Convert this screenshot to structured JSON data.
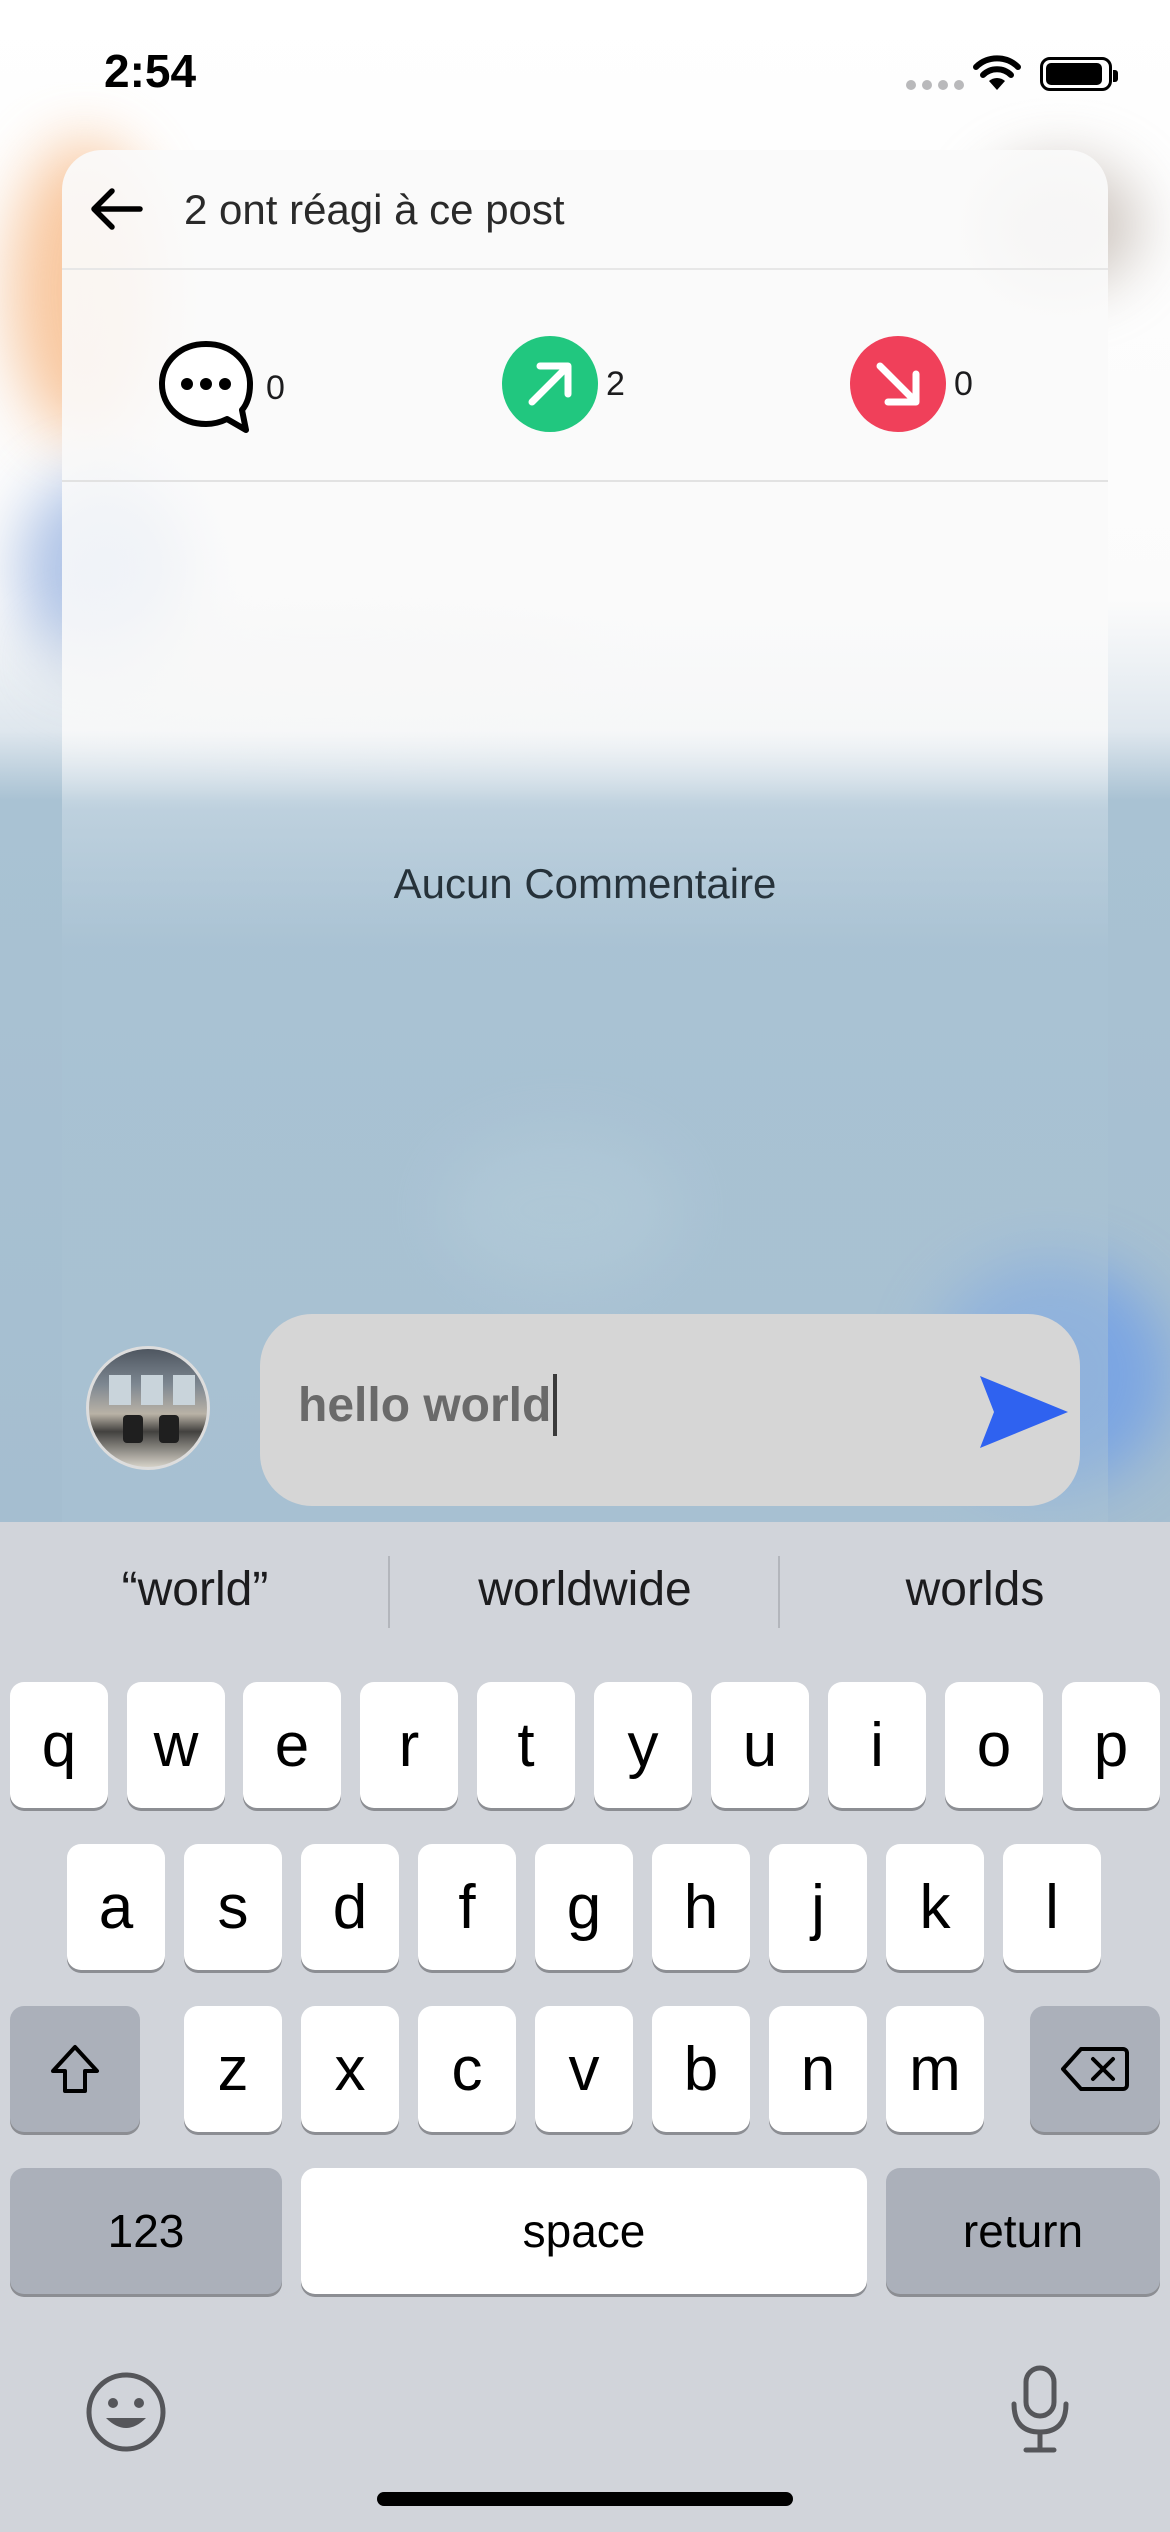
{
  "status_bar": {
    "time": "2:54",
    "icons": [
      "cellular-dots-icon",
      "wifi-icon",
      "battery-icon"
    ]
  },
  "header": {
    "back_icon": "arrow-left-icon",
    "title": "2 ont réagi à ce post"
  },
  "reactions": [
    {
      "icon": "comment-bubble-icon",
      "count": "0",
      "color": "#000000"
    },
    {
      "icon": "arrow-up-right-icon",
      "count": "2",
      "color": "#21c77f"
    },
    {
      "icon": "arrow-down-right-icon",
      "count": "0",
      "color": "#f0405a"
    }
  ],
  "comments": {
    "empty_text": "Aucun Commentaire"
  },
  "composer": {
    "value": "hello world",
    "send_icon": "send-icon",
    "send_color": "#2f62f0"
  },
  "keyboard": {
    "suggestions": [
      "“world”",
      "worldwide",
      "worlds"
    ],
    "row1": [
      "q",
      "w",
      "e",
      "r",
      "t",
      "y",
      "u",
      "i",
      "o",
      "p"
    ],
    "row2": [
      "a",
      "s",
      "d",
      "f",
      "g",
      "h",
      "j",
      "k",
      "l"
    ],
    "row3": [
      "z",
      "x",
      "c",
      "v",
      "b",
      "n",
      "m"
    ],
    "shift_icon": "shift-icon",
    "delete_icon": "delete-icon",
    "numbers_label": "123",
    "space_label": "space",
    "return_label": "return",
    "emoji_icon": "emoji-icon",
    "mic_icon": "microphone-icon"
  }
}
